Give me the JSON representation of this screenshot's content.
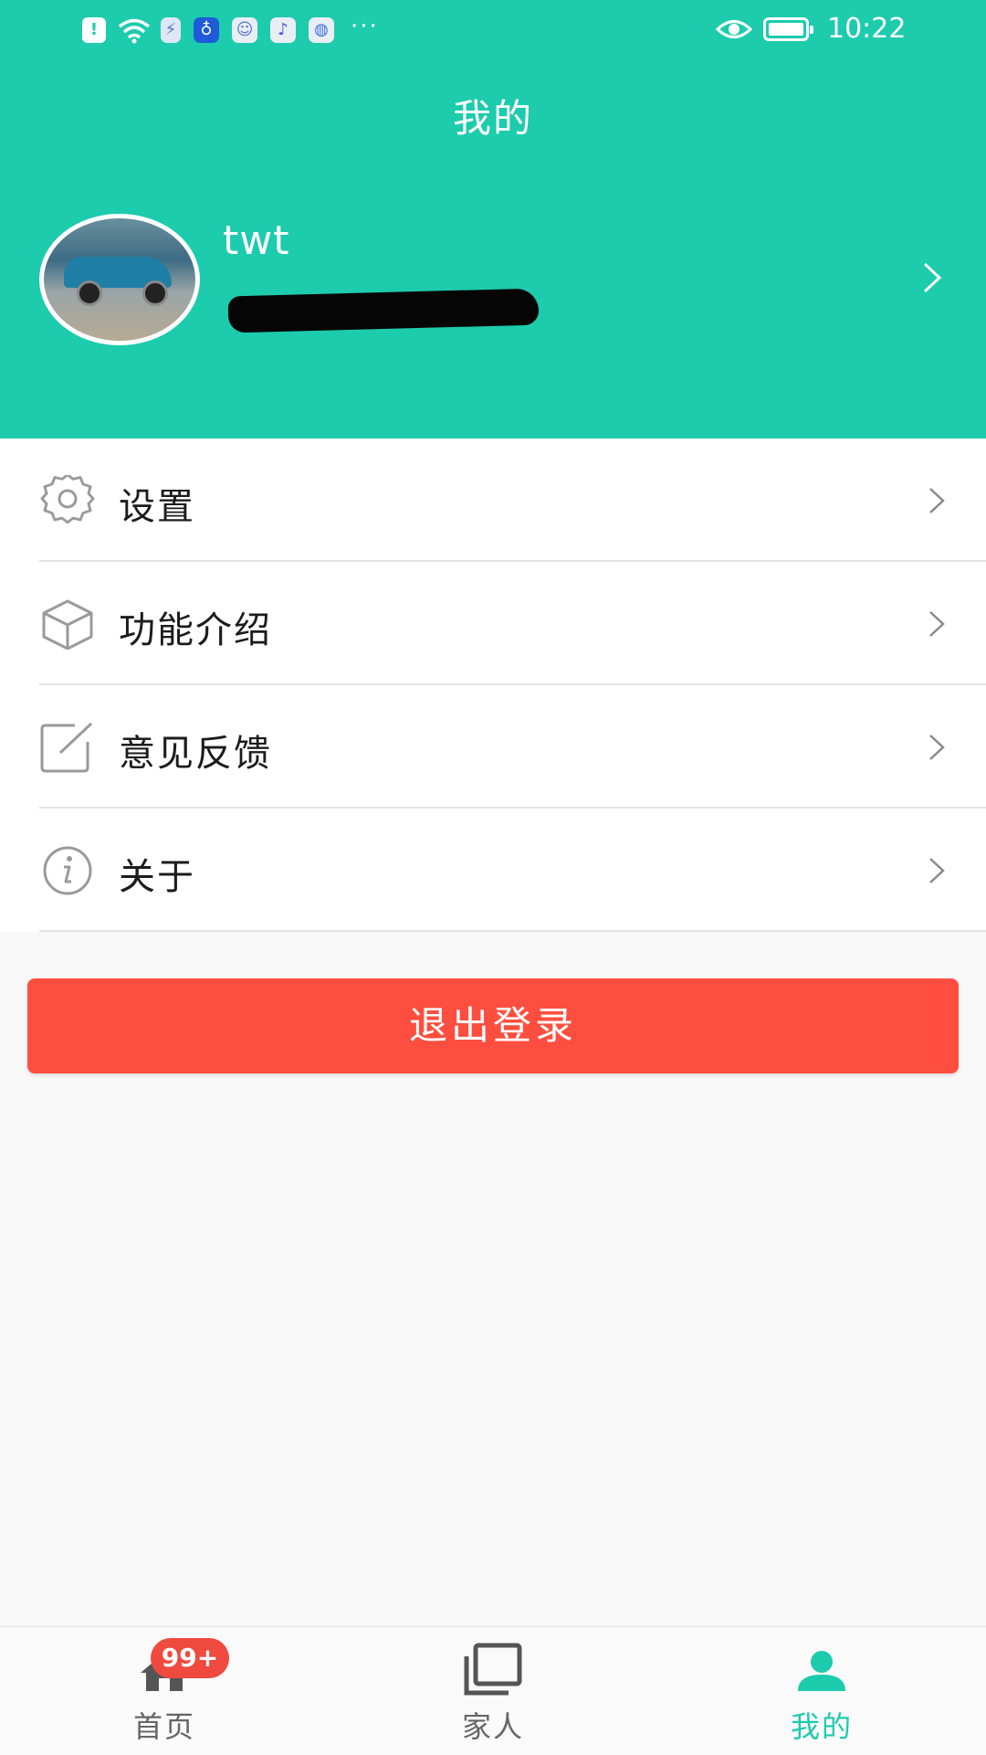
{
  "status_bar": {
    "time": "10:22",
    "more_indicator": "···",
    "icons": [
      "alert-icon",
      "wifi-icon",
      "charge-icon",
      "bulb-app-icon",
      "people-app-icon",
      "music-app-icon",
      "browser-app-icon",
      "eye-icon",
      "battery-icon"
    ]
  },
  "header": {
    "title": "我的"
  },
  "profile": {
    "username": "twt",
    "phone": "redacted"
  },
  "menu": {
    "items": [
      {
        "label": "设置",
        "icon": "gear-icon"
      },
      {
        "label": "功能介绍",
        "icon": "cube-icon"
      },
      {
        "label": "意见反馈",
        "icon": "edit-icon"
      },
      {
        "label": "关于",
        "icon": "info-icon"
      }
    ]
  },
  "logout": {
    "label": "退出登录"
  },
  "tabbar": {
    "tabs": [
      {
        "label": "首页",
        "icon": "home-icon",
        "badge": "99+"
      },
      {
        "label": "家人",
        "icon": "family-icon"
      },
      {
        "label": "我的",
        "icon": "person-icon",
        "active": true
      }
    ]
  },
  "colors": {
    "brand": "#1dcbad",
    "danger": "#fe4e3f",
    "badge": "#ef4a3f"
  }
}
